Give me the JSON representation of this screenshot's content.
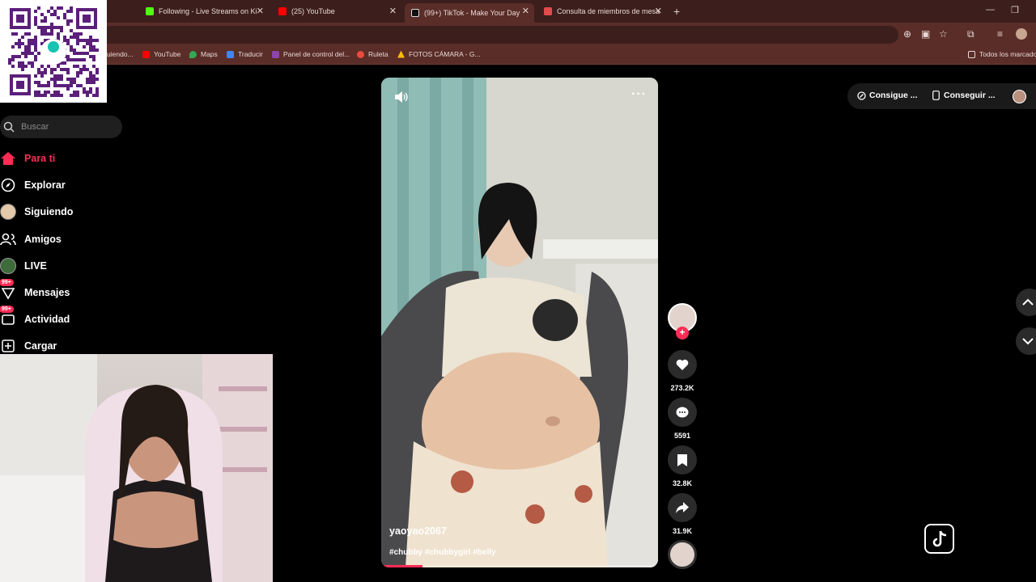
{
  "browser": {
    "tabs": [
      {
        "title": "Following - Live Streams on Ki",
        "color": "#53fc18"
      },
      {
        "title": "(25) YouTube",
        "color": "#ff0000"
      },
      {
        "title": "(99+) TikTok - Make Your Day",
        "color": "#000000",
        "active": true
      },
      {
        "title": "Consulta de miembros de mesa",
        "color": "#e24b4b"
      }
    ],
    "bookmarks": [
      {
        "label": "uiendo...",
        "color": "#7a7a7a"
      },
      {
        "label": "YouTube",
        "color": "#ff0000"
      },
      {
        "label": "Maps",
        "color": "#34a853"
      },
      {
        "label": "Traducir",
        "color": "#4285f4"
      },
      {
        "label": "Panel de control del...",
        "color": "#8e44ad"
      },
      {
        "label": "Ruleta",
        "color": "#e74c3c"
      },
      {
        "label": "FOTOS CÁMARA - G...",
        "color": "#fbbc05"
      }
    ],
    "all_bookmarks": "Todos los marcado"
  },
  "sidebar": {
    "search_placeholder": "Buscar",
    "items": [
      {
        "label": "Para ti",
        "icon": "home-icon"
      },
      {
        "label": "Explorar",
        "icon": "compass-icon"
      },
      {
        "label": "Siguiendo",
        "icon": "avatar-icon"
      },
      {
        "label": "Amigos",
        "icon": "friends-icon"
      },
      {
        "label": "LIVE",
        "icon": "live-icon"
      },
      {
        "label": "Mensajes",
        "icon": "message-icon",
        "badge": "99+"
      },
      {
        "label": "Actividad",
        "icon": "inbox-icon",
        "badge": "99+"
      },
      {
        "label": "Cargar",
        "icon": "upload-icon"
      }
    ]
  },
  "video": {
    "username": "yaoyao2067",
    "hashtags": "#chubby #chubbygirl #belly",
    "progress": 0.15
  },
  "actions": {
    "likes": "273.2K",
    "comments": "5591",
    "saves": "32.8K",
    "shares": "31.9K"
  },
  "top_right": {
    "get_coins": "Consigue ...",
    "get_app": "Conseguir ..."
  },
  "colors": {
    "accent": "#fe2c55",
    "chrome": "#5a2d28"
  }
}
